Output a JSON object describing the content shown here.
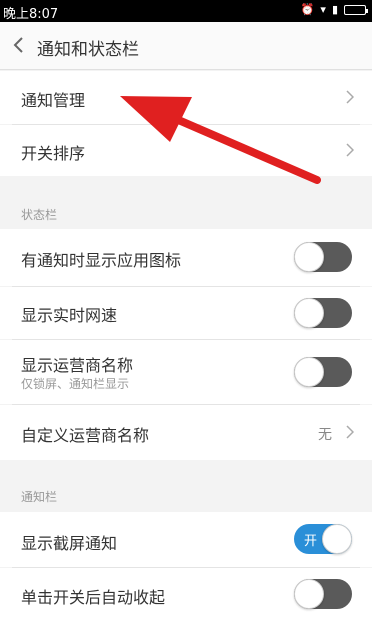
{
  "status_bar": {
    "time": "晚上8:07"
  },
  "titlebar": {
    "title": "通知和状态栏"
  },
  "rows_top": [
    {
      "label": "通知管理"
    },
    {
      "label": "开关排序"
    }
  ],
  "section_status": {
    "label": "状态栏",
    "items": [
      {
        "label": "有通知时显示应用图标",
        "toggle": "off"
      },
      {
        "label": "显示实时网速",
        "toggle": "off"
      },
      {
        "label": "显示运营商名称",
        "sub": "仅锁屏、通知栏显示",
        "toggle": "off"
      },
      {
        "label": "自定义运营商名称",
        "value": "无"
      }
    ]
  },
  "section_notify": {
    "label": "通知栏",
    "items": [
      {
        "label": "显示截屏通知",
        "toggle": "on",
        "toggle_text": "开"
      },
      {
        "label": "单击开关后自动收起",
        "toggle": "off"
      }
    ]
  },
  "colors": {
    "accent": "#2a8fd8",
    "arrow": "#e02020",
    "toggle_off": "#5a5a5a"
  }
}
